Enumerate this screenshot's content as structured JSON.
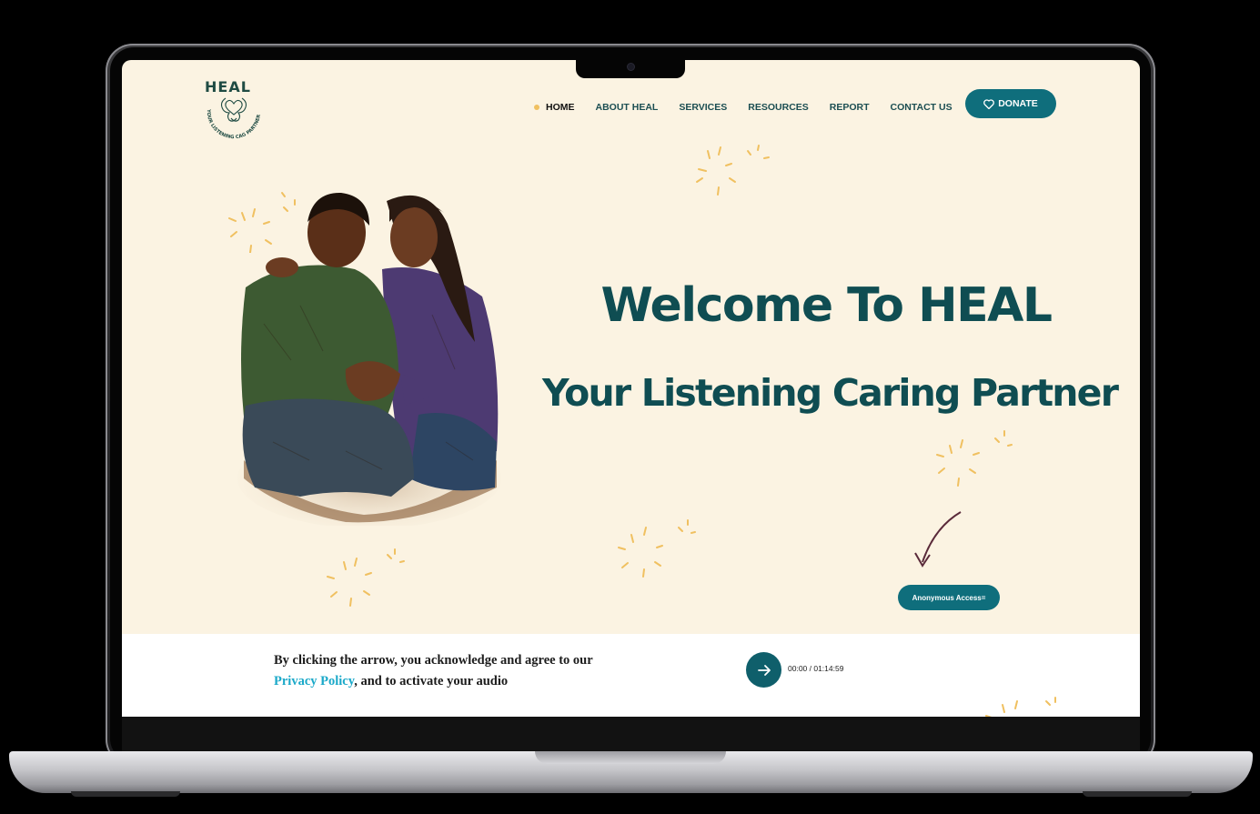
{
  "site": {
    "logo_text": "HEAL",
    "logo_tagline": "YOUR LISTENING CAG PARTNER"
  },
  "nav": {
    "items": [
      {
        "label": "HOME",
        "active": true
      },
      {
        "label": "ABOUT HEAL"
      },
      {
        "label": "SERVICES"
      },
      {
        "label": "RESOURCES"
      },
      {
        "label": "REPORT"
      },
      {
        "label": "CONTACT US"
      }
    ],
    "donate_label": "DONATE",
    "donate_icon": "heart-icon"
  },
  "hero": {
    "title": "Welcome To HEAL",
    "subtitle": "Your Listening Caring Partner",
    "anonymous_label": "Anonymous Access="
  },
  "consent": {
    "line1": "By clicking the arrow, you acknowledge and agree to our",
    "privacy_link": "Privacy Policy",
    "line2_rest": ", and to  activate your audio",
    "audio_time": "00:00 / 01:14:59",
    "arrow_icon": "arrow-right-icon"
  },
  "colors": {
    "background": "#fbf3e2",
    "primary": "#0f6e7c",
    "heading": "#0f4d52",
    "sparkle": "#f0c060",
    "link": "#1ba9c9"
  }
}
